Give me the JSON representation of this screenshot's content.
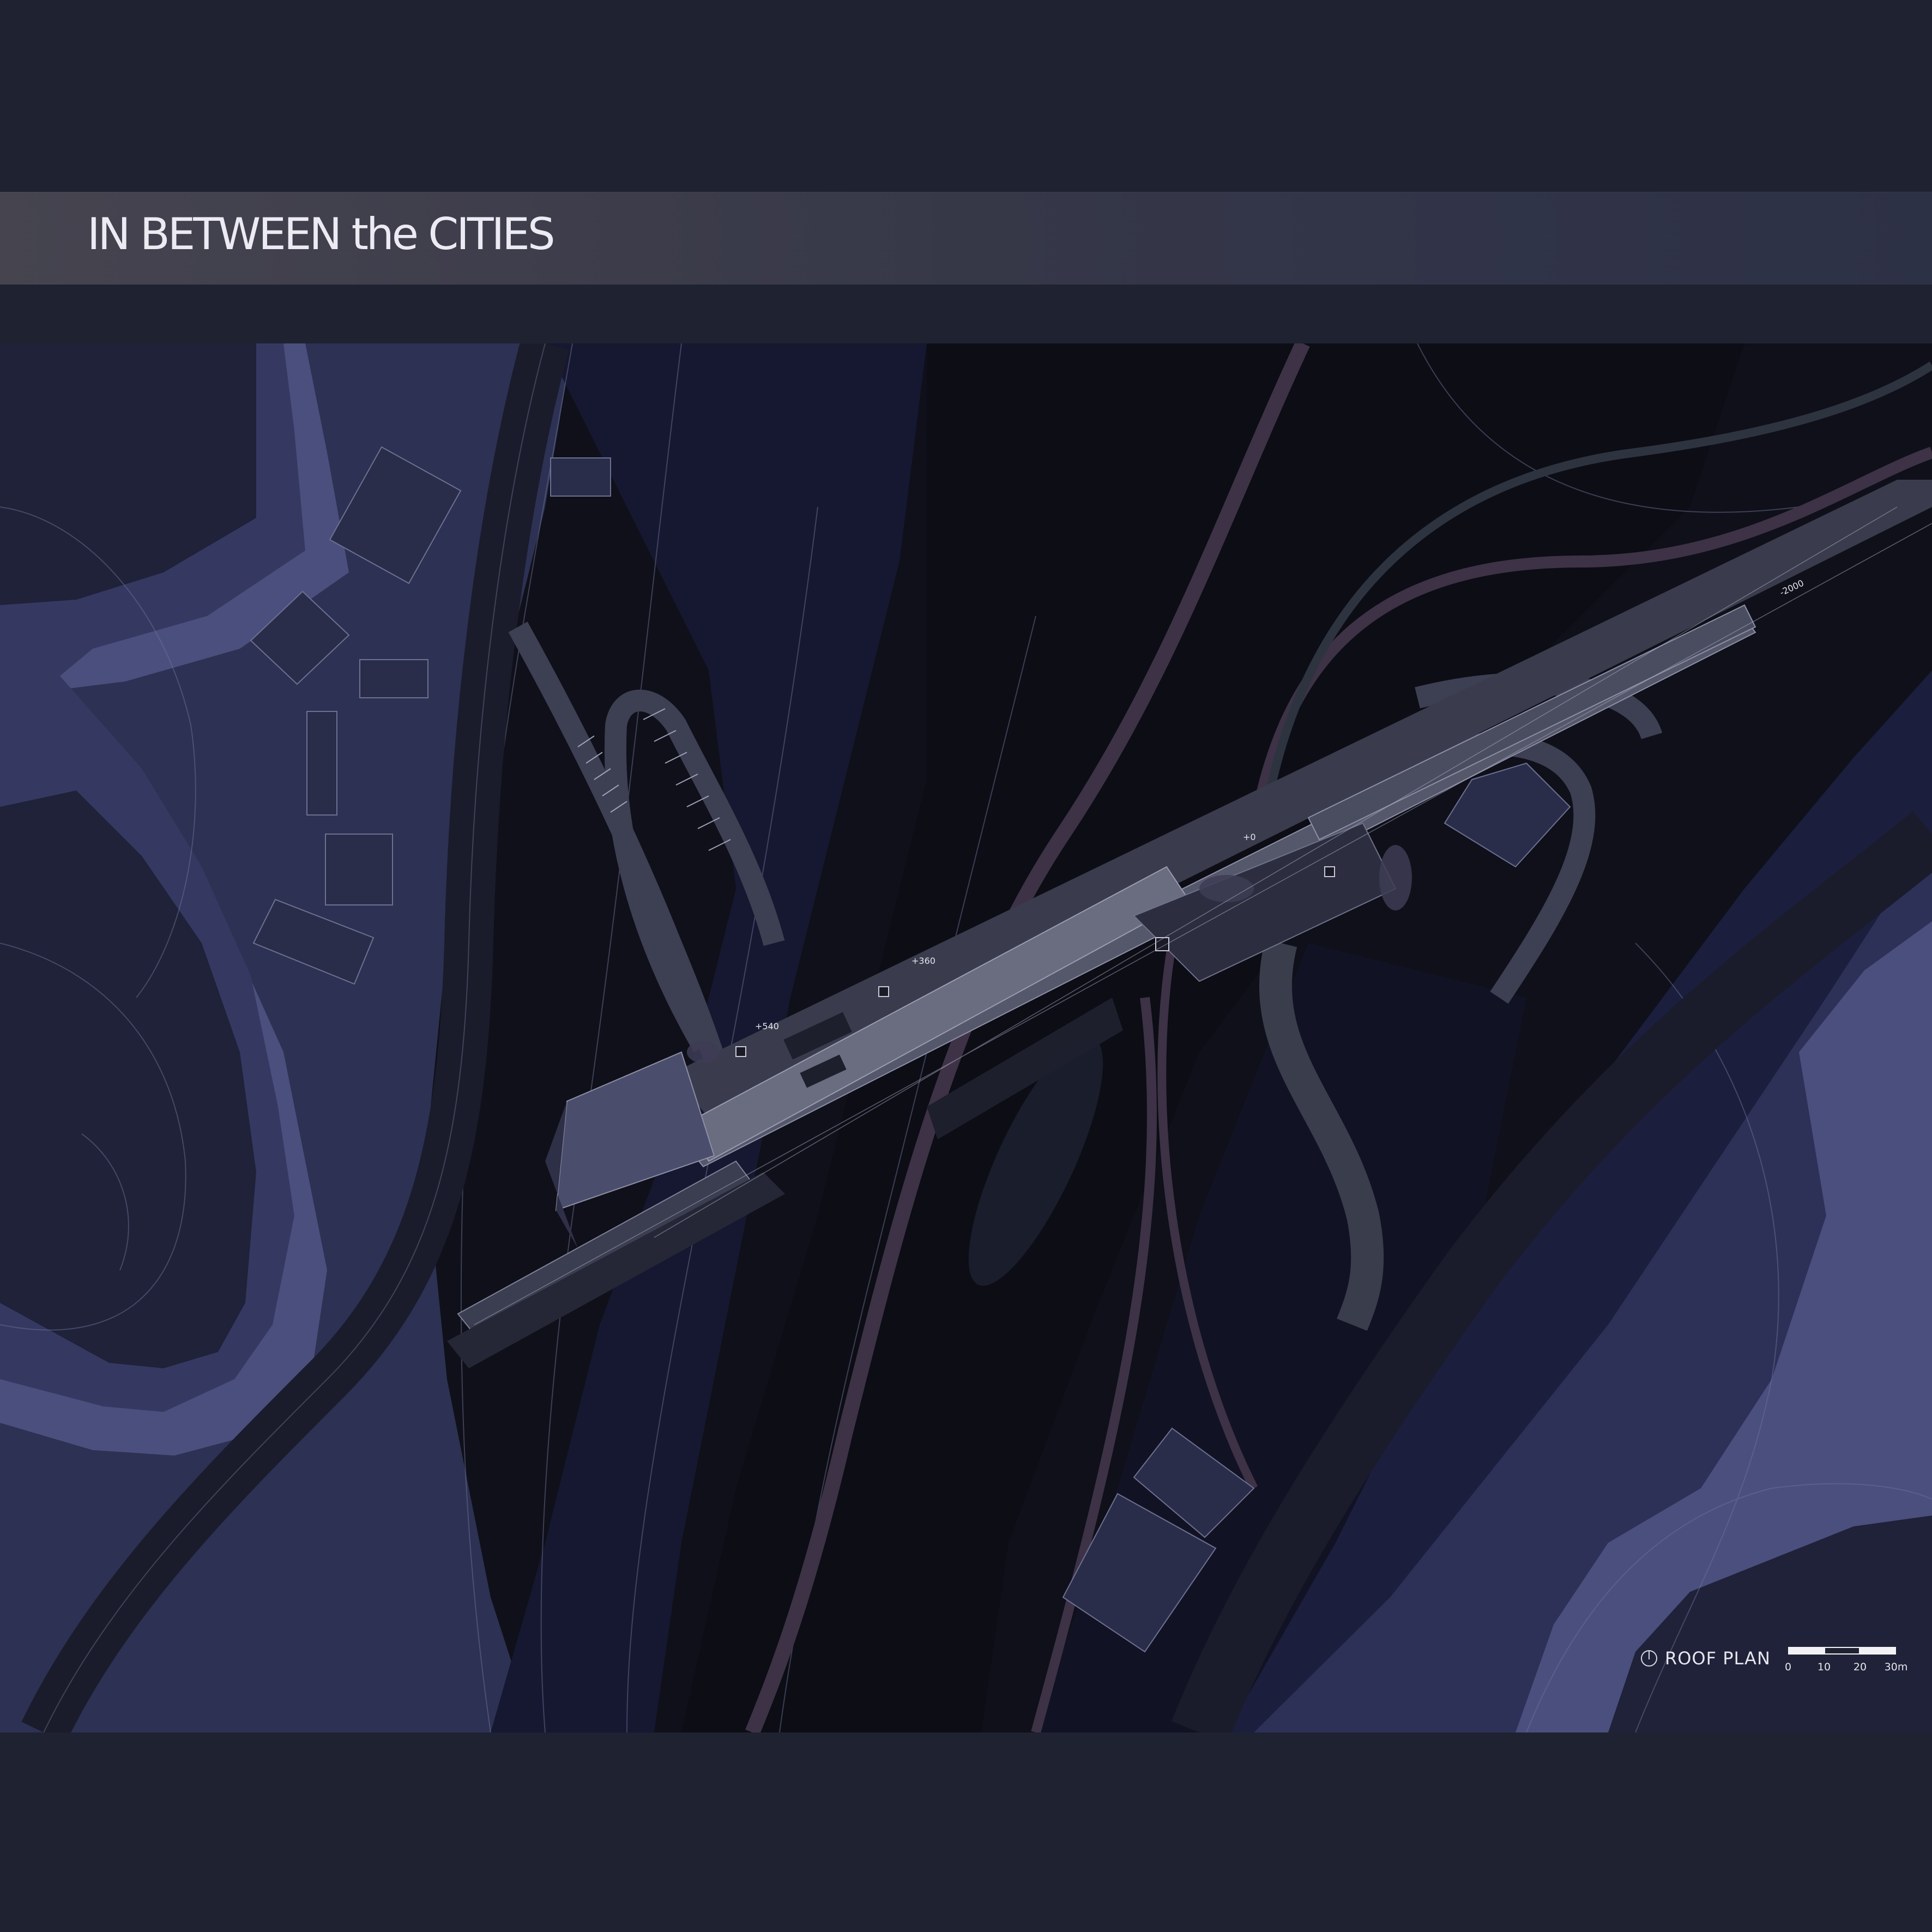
{
  "header": {
    "title": "IN BETWEEN the CITIES"
  },
  "plan": {
    "level_labels": [
      {
        "key": "a",
        "text": "+540"
      },
      {
        "key": "b",
        "text": "+360"
      },
      {
        "key": "c",
        "text": "+0"
      },
      {
        "key": "d",
        "text": "-2000"
      }
    ]
  },
  "legend": {
    "title": "ROOF PLAN",
    "scale_ticks": [
      "0",
      "10",
      "20",
      "30m"
    ]
  },
  "colors": {
    "page_background": "#1f2231",
    "terrain_light": "#4f5584",
    "terrain_mid": "#2e3358",
    "terrain_dark": "#151727",
    "road": "#1a1c2b",
    "building": "#5a5c70",
    "rail": "#4a3b52"
  }
}
